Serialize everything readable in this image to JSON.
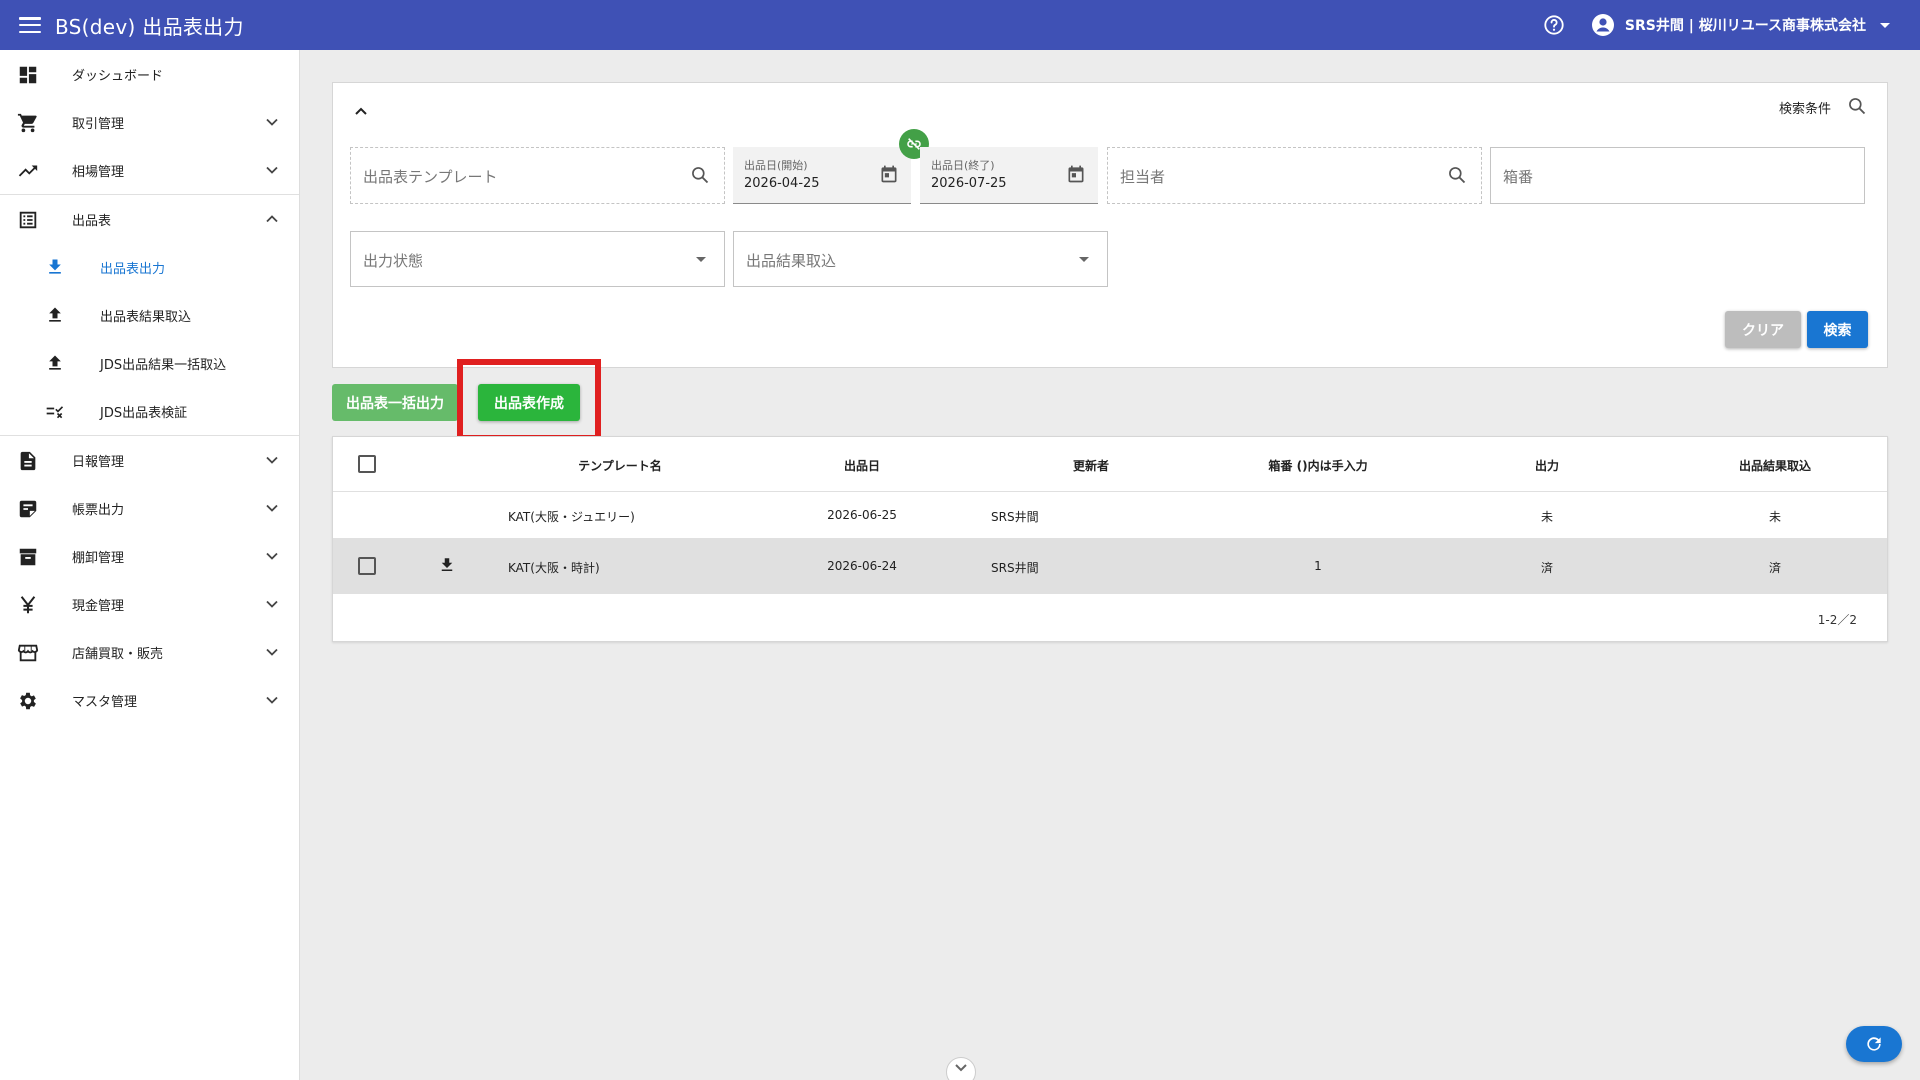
{
  "header": {
    "title": "BS(dev) 出品表出力",
    "user": "SRS井間 | 桜川リユース商事株式会社"
  },
  "sidebar": {
    "items": [
      {
        "label": "ダッシュボード"
      },
      {
        "label": "取引管理"
      },
      {
        "label": "相場管理"
      },
      {
        "label": "出品表"
      },
      {
        "label": "出品表出力"
      },
      {
        "label": "出品表結果取込"
      },
      {
        "label": "JDS出品結果一括取込"
      },
      {
        "label": "JDS出品表検証"
      },
      {
        "label": "日報管理"
      },
      {
        "label": "帳票出力"
      },
      {
        "label": "棚卸管理"
      },
      {
        "label": "現金管理"
      },
      {
        "label": "店舗買取・販売"
      },
      {
        "label": "マスタ管理"
      }
    ]
  },
  "search": {
    "conditions_label": "検索条件",
    "template_placeholder": "出品表テンプレート",
    "date_start_label": "出品日(開始)",
    "date_start_value": "2026-04-25",
    "date_end_label": "出品日(終了)",
    "date_end_value": "2026-07-25",
    "staff_placeholder": "担当者",
    "box_placeholder": "箱番",
    "output_status_placeholder": "出力状態",
    "result_import_placeholder": "出品結果取込",
    "clear_label": "クリア",
    "search_label": "検索"
  },
  "actions": {
    "bulk_output_label": "出品表一括出力",
    "create_label": "出品表作成"
  },
  "table": {
    "columns": [
      "テンプレート名",
      "出品日",
      "更新者",
      "箱番 ()内は手入力",
      "出力",
      "出品結果取込"
    ],
    "rows": [
      {
        "template": "KAT(大阪・ジュエリー)",
        "date": "2026-06-25",
        "updater": "SRS井間",
        "box": "",
        "output": "未",
        "result": "未"
      },
      {
        "template": "KAT(大阪・時計)",
        "date": "2026-06-24",
        "updater": "SRS井間",
        "box": "1",
        "output": "済",
        "result": "済"
      }
    ],
    "pager": "1-2／2"
  },
  "colors": {
    "header": "#3f51b5",
    "primary": "#1976d2",
    "success": "#2bb53c",
    "highlight": "#e02020"
  }
}
